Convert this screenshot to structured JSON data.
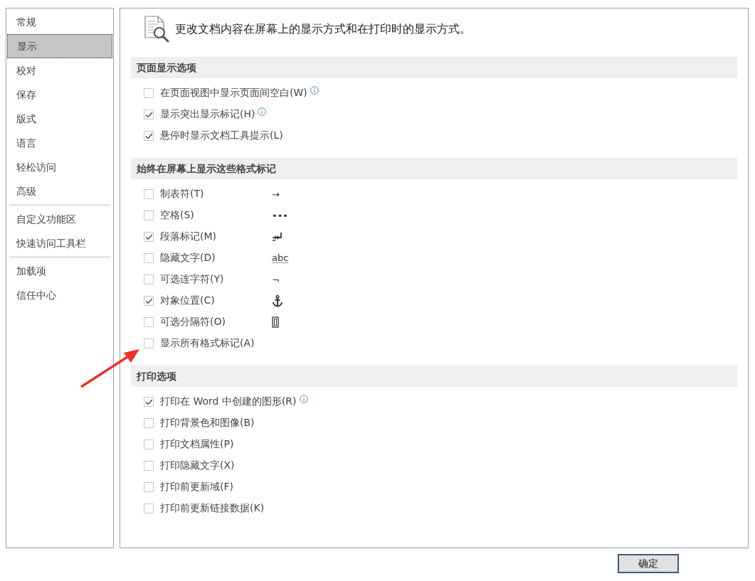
{
  "sidebar": {
    "groups": [
      {
        "items": [
          {
            "label": "常规",
            "selected": false
          },
          {
            "label": "显示",
            "selected": true
          },
          {
            "label": "校对",
            "selected": false
          },
          {
            "label": "保存",
            "selected": false
          },
          {
            "label": "版式",
            "selected": false
          },
          {
            "label": "语言",
            "selected": false
          },
          {
            "label": "轻松访问",
            "selected": false
          },
          {
            "label": "高级",
            "selected": false
          }
        ]
      },
      {
        "items": [
          {
            "label": "自定义功能区",
            "selected": false
          },
          {
            "label": "快速访问工具栏",
            "selected": false
          }
        ]
      },
      {
        "items": [
          {
            "label": "加载项",
            "selected": false
          },
          {
            "label": "信任中心",
            "selected": false
          }
        ]
      }
    ]
  },
  "intro": "更改文档内容在屏幕上的显示方式和在打印时的显示方式。",
  "sections": [
    {
      "title": "页面显示选项",
      "options": [
        {
          "label": "在页面视图中显示页面间空白(W)",
          "checked": false,
          "info": true
        },
        {
          "label": "显示突出显示标记(H)",
          "checked": true,
          "info": true
        },
        {
          "label": "悬停时显示文档工具提示(L)",
          "checked": true,
          "info": false
        }
      ]
    },
    {
      "title": "始终在屏幕上显示这些格式标记",
      "options": [
        {
          "label": "制表符(T)",
          "checked": false,
          "info": false,
          "mark": {
            "kind": "text",
            "text": "→"
          }
        },
        {
          "label": "空格(S)",
          "checked": false,
          "info": false,
          "mark": {
            "kind": "text",
            "text": "•••"
          }
        },
        {
          "label": "段落标记(M)",
          "checked": true,
          "info": false,
          "mark": {
            "kind": "paragraph"
          }
        },
        {
          "label": "隐藏文字(D)",
          "checked": false,
          "info": false,
          "mark": {
            "kind": "dotted",
            "text": "abc"
          }
        },
        {
          "label": "可选连字符(Y)",
          "checked": false,
          "info": false,
          "mark": {
            "kind": "text",
            "text": "¬"
          }
        },
        {
          "label": "对象位置(C)",
          "checked": true,
          "info": false,
          "mark": {
            "kind": "anchor"
          }
        },
        {
          "label": "可选分隔符(O)",
          "checked": false,
          "info": false,
          "mark": {
            "kind": "box"
          }
        },
        {
          "label": "显示所有格式标记(A)",
          "checked": false,
          "info": false
        }
      ]
    },
    {
      "title": "打印选项",
      "options": [
        {
          "label": "打印在 Word 中创建的图形(R)",
          "checked": true,
          "info": true
        },
        {
          "label": "打印背景色和图像(B)",
          "checked": false,
          "info": false
        },
        {
          "label": "打印文档属性(P)",
          "checked": false,
          "info": false
        },
        {
          "label": "打印隐藏文字(X)",
          "checked": false,
          "info": false
        },
        {
          "label": "打印前更新域(F)",
          "checked": false,
          "info": false
        },
        {
          "label": "打印前更新链接数据(K)",
          "checked": false,
          "info": false
        }
      ]
    }
  ],
  "buttons": [
    {
      "label": "确定"
    }
  ]
}
